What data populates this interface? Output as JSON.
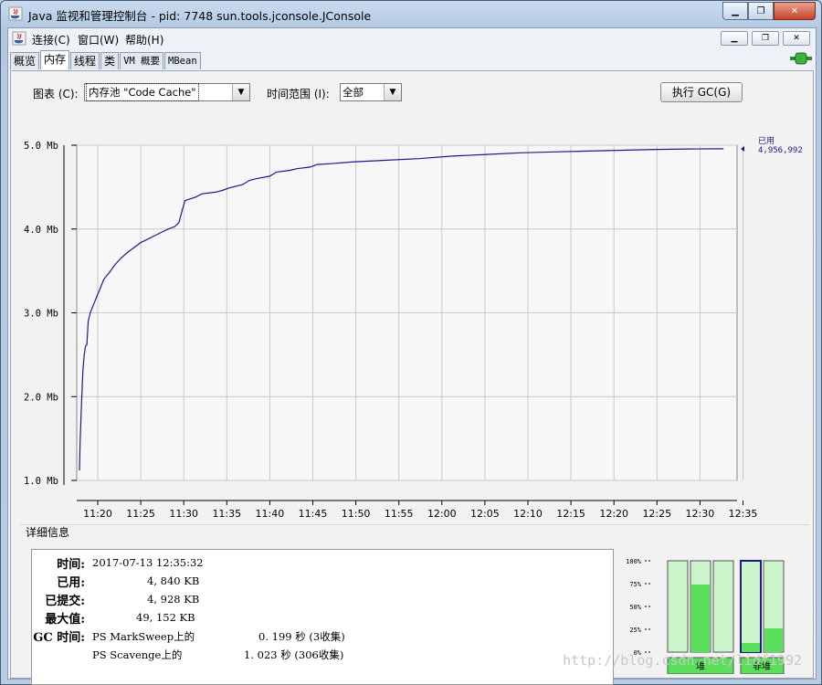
{
  "window": {
    "title": "Java 监视和管理控制台 - pid: 7748 sun.tools.jconsole.JConsole"
  },
  "menu": {
    "items": [
      "连接(C)",
      "窗口(W)",
      "帮助(H)"
    ]
  },
  "tabs": [
    "概览",
    "内存",
    "线程",
    "类",
    "VM 概要",
    "MBean"
  ],
  "active_tab": "内存",
  "controls": {
    "chart_label": "图表 (C):",
    "chart_value": "内存池 \"Code Cache\"",
    "range_label": "时间范围 (I):",
    "range_value": "全部",
    "gc_button": "执行 GC(G)"
  },
  "chart_data": {
    "type": "line",
    "y_ticks": [
      "5.0 Mb",
      "4.0 Mb",
      "3.0 Mb",
      "2.0 Mb",
      "1.0 Mb"
    ],
    "ylim": [
      1.0,
      5.0
    ],
    "x_ticks": [
      "11:20",
      "11:25",
      "11:30",
      "11:35",
      "11:40",
      "11:45",
      "11:50",
      "11:55",
      "12:00",
      "12:05",
      "12:10",
      "12:15",
      "12:20",
      "12:25",
      "12:30",
      "12:35"
    ],
    "series": [
      {
        "name": "已用",
        "color": "#1a1a8c",
        "points": [
          [
            -0.1,
            1.12
          ],
          [
            0.0,
            1.45
          ],
          [
            0.2,
            1.9
          ],
          [
            0.4,
            2.3
          ],
          [
            0.6,
            2.5
          ],
          [
            0.8,
            2.6
          ],
          [
            1.0,
            2.62
          ],
          [
            1.2,
            2.9
          ],
          [
            1.5,
            3.0
          ],
          [
            2.0,
            3.1
          ],
          [
            2.5,
            3.2
          ],
          [
            3.0,
            3.3
          ],
          [
            3.5,
            3.4
          ],
          [
            4.0,
            3.45
          ],
          [
            4.5,
            3.5
          ],
          [
            5.0,
            3.56
          ],
          [
            6.0,
            3.65
          ],
          [
            7.0,
            3.72
          ],
          [
            8.0,
            3.78
          ],
          [
            9.0,
            3.84
          ],
          [
            10.0,
            3.88
          ],
          [
            11.0,
            3.92
          ],
          [
            12.0,
            3.96
          ],
          [
            13.0,
            4.0
          ],
          [
            14.0,
            4.03
          ],
          [
            14.6,
            4.08
          ],
          [
            15.0,
            4.2
          ],
          [
            15.5,
            4.34
          ],
          [
            17.0,
            4.38
          ],
          [
            18.0,
            4.42
          ],
          [
            20.0,
            4.44
          ],
          [
            21.0,
            4.46
          ],
          [
            22.0,
            4.49
          ],
          [
            24.0,
            4.53
          ],
          [
            25.0,
            4.58
          ],
          [
            26.0,
            4.6
          ],
          [
            28.0,
            4.63
          ],
          [
            29.0,
            4.68
          ],
          [
            31.0,
            4.7
          ],
          [
            32.0,
            4.72
          ],
          [
            34.0,
            4.74
          ],
          [
            35.0,
            4.77
          ],
          [
            37.0,
            4.78
          ],
          [
            40.0,
            4.8
          ],
          [
            45.0,
            4.82
          ],
          [
            50.0,
            4.84
          ],
          [
            55.0,
            4.87
          ],
          [
            60.0,
            4.89
          ],
          [
            65.0,
            4.91
          ],
          [
            70.0,
            4.92
          ],
          [
            75.0,
            4.93
          ],
          [
            80.0,
            4.94
          ],
          [
            85.0,
            4.95
          ],
          [
            90.0,
            4.955
          ],
          [
            95.0,
            4.957
          ]
        ],
        "latest_label": "已用",
        "latest_value": "4,956,992"
      }
    ]
  },
  "details": {
    "section_title": "详细信息",
    "time_label": "时间:",
    "time_value": "2017-07-13 12:35:32",
    "used_label": "已用:",
    "used_value": "4, 840 KB",
    "committed_label": "已提交:",
    "committed_value": "4, 928 KB",
    "max_label": "最大值:",
    "max_value": "49, 152 KB",
    "gc_label": "GC 时间:",
    "gc_rows": [
      {
        "name": "PS MarkSweep上的",
        "value": "0. 199  秒 (3收集)"
      },
      {
        "name": "PS Scavenge上的",
        "value": "1. 023  秒 (306收集)"
      }
    ]
  },
  "pool_bars": {
    "ticks": [
      "100%",
      "75%",
      "50%",
      "25%",
      "0%"
    ],
    "heap_label": "堆",
    "nonheap_label": "非堆",
    "heap": [
      0.0,
      0.74,
      0.0
    ],
    "nonheap": [
      0.1,
      0.26
    ]
  },
  "watermark": "http://blog.csdn.net/lidf1992"
}
